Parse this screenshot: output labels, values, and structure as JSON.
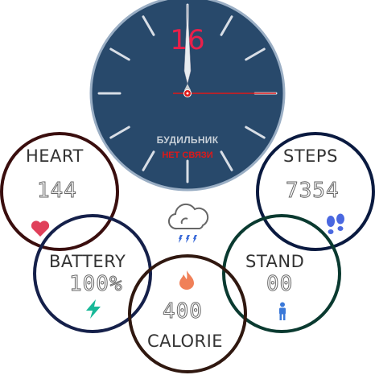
{
  "watch": {
    "date": "16",
    "alarm_label": "БУДИЛЬНИК",
    "connection_status": "НЕТ СВЯЗИ"
  },
  "colors": {
    "dial": "#28496b",
    "date": "#e8204a",
    "second_hand": "#e01818",
    "status": "#e01818"
  },
  "widgets": {
    "heart": {
      "title": "HEART",
      "value": "144",
      "icon": "heart-icon",
      "ring_color": "#3a0e0e",
      "icon_color": "#e0405a"
    },
    "battery": {
      "title": "BATTERY",
      "value": "100%",
      "icon": "lightning-icon",
      "ring_color": "#15204a",
      "icon_color": "#18b898"
    },
    "calorie": {
      "title": "CALORIE",
      "value": "400",
      "icon": "flame-icon",
      "ring_color": "#301810",
      "icon_color": "#f08058"
    },
    "stand": {
      "title": "STAND",
      "value": "00",
      "icon": "person-icon",
      "ring_color": "#0a3a30",
      "icon_color": "#3a78d8"
    },
    "steps": {
      "title": "STEPS",
      "value": "7354",
      "icon": "footprints-icon",
      "ring_color": "#0a1a40",
      "icon_color": "#4a68e0"
    }
  },
  "weather": {
    "icon": "cloud-rain-icon"
  }
}
